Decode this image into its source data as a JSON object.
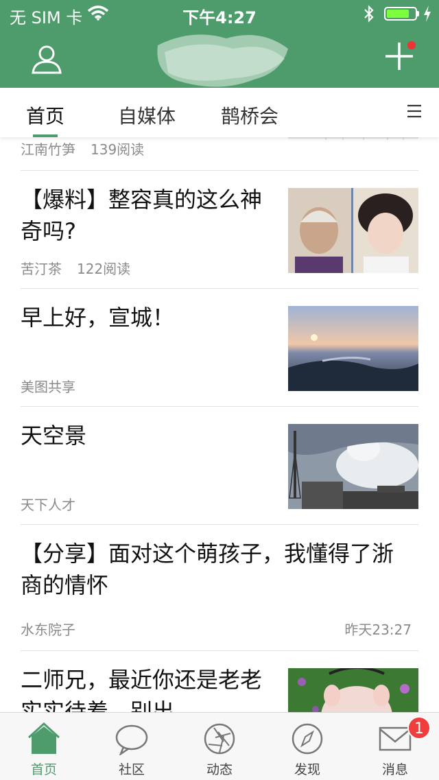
{
  "status_bar": {
    "carrier": "无 SIM 卡",
    "time": "下午4:27",
    "battery_percent": 80
  },
  "header": {
    "user_icon": "user-icon",
    "add_icon": "plus-icon",
    "notification_dot": true
  },
  "tabs": [
    "首页",
    "自媒体",
    "鹊桥会"
  ],
  "active_tab": "首页",
  "feed": [
    {
      "title": "",
      "author": "江南竹笋",
      "reads": "139阅读"
    },
    {
      "title": "【爆料】整容真的这么神奇吗?",
      "author": "苦汀茶",
      "reads": "122阅读"
    },
    {
      "title": "早上好，宣城！",
      "author": "美图共享",
      "reads": ""
    },
    {
      "title": "天空景",
      "author": "天下人才",
      "reads": ""
    },
    {
      "title": "【分享】面对这个萌孩子，我懂得了浙商的情怀",
      "author": "水东院子",
      "time": "昨天23:27"
    },
    {
      "title": "二师兄，最近你还是老老实实待着，别出",
      "author": "",
      "reads": ""
    }
  ],
  "tabbar": {
    "items": [
      "首页",
      "社区",
      "动态",
      "发现",
      "消息"
    ],
    "active": "首页",
    "message_badge": "1"
  },
  "colors": {
    "brand": "#4e9c6b",
    "badge": "#f03c3c"
  }
}
